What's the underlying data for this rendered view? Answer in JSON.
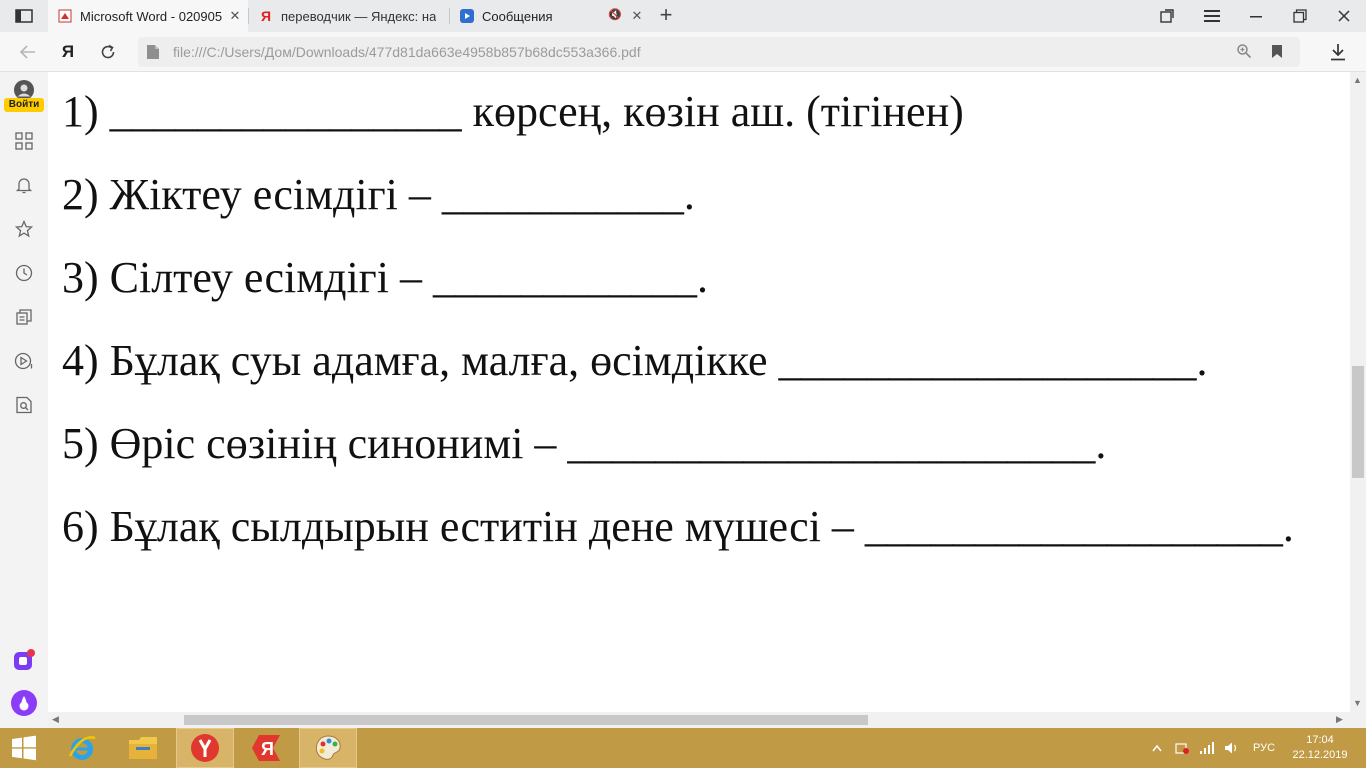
{
  "tabs": [
    {
      "title": "Microsoft Word - 020905",
      "favicon": "pdf-icon",
      "active": true
    },
    {
      "title": "переводчик — Яндекс: на",
      "favicon": "yandex-icon",
      "active": false
    },
    {
      "title": "Сообщения",
      "favicon": "video-icon",
      "active": false
    }
  ],
  "address": {
    "url": "file:///C:/Users/Дом/Downloads/477d81da663e4958b857b68dc553a366.pdf",
    "yandex_letter": "Я"
  },
  "sidebar": {
    "login_label": "Войти"
  },
  "document": {
    "lines": [
      "1) ________________ көрсең, көзін аш. (тігінен)",
      "2) Жіктеу есімдігі – ___________.",
      "3) Сілтеу есімдігі – ____________.",
      "4) Бұлақ суы адамға, малға, өсімдікке ___________________.",
      "5) Өріс сөзінің синонимі – ________________________.",
      "6) Бұлақ сылдырын еститін дене мүшесі – ___________________."
    ]
  },
  "taskbar": {
    "language": "РУС",
    "time": "17:04",
    "date": "22.12.2019"
  },
  "colors": {
    "taskbar": "#c19a45",
    "tab_bar": "#e9eaec",
    "login_badge": "#ffcc00"
  }
}
